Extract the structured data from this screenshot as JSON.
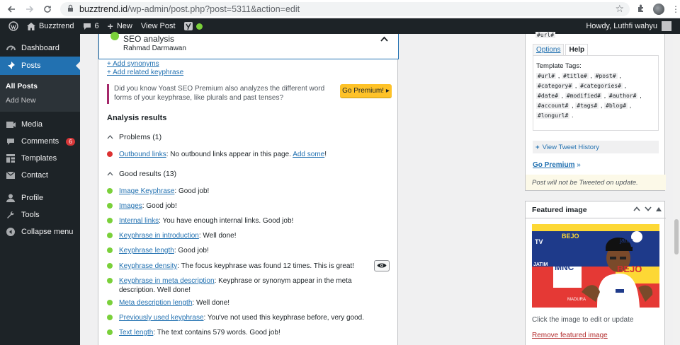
{
  "browser": {
    "url_host": "buzztrend.id",
    "url_path": "/wp-admin/post.php?post=5311&action=edit"
  },
  "adminbar": {
    "site_name": "Buzztrend",
    "comments_count": "6",
    "new_label": "New",
    "view_post_label": "View Post",
    "howdy": "Howdy, Luthfi wahyu"
  },
  "sidebar": {
    "dashboard": "Dashboard",
    "posts": "Posts",
    "all_posts": "All Posts",
    "add_new": "Add New",
    "media": "Media",
    "comments": "Comments",
    "comments_badge": "6",
    "templates": "Templates",
    "contact": "Contact",
    "profile": "Profile",
    "tools": "Tools",
    "collapse": "Collapse menu"
  },
  "seo": {
    "title": "SEO analysis",
    "keyphrase": "Rahmad Darmawan",
    "add_synonyms": "+ Add synonyms",
    "add_related": "+ Add related keyphrase",
    "promo_text": "Did you know Yoast SEO Premium also analyzes the different word forms of your keyphrase, like plurals and past tenses?",
    "go_premium_btn": "Go Premium! ▸",
    "analysis_results": "Analysis results",
    "problems_header": "Problems (1)",
    "good_header": "Good results (13)",
    "problems": [
      {
        "link": "Outbound links",
        "text": ": No outbound links appear in this page. ",
        "extra_link": "Add some",
        "tail": "!"
      }
    ],
    "good": [
      {
        "link": "Image Keyphrase",
        "text": ": Good job!"
      },
      {
        "link": "Images",
        "text": ": Good job!"
      },
      {
        "link": "Internal links",
        "text": ": You have enough internal links. Good job!"
      },
      {
        "link": "Keyphrase in introduction",
        "text": ": Well done!"
      },
      {
        "link": "Keyphrase length",
        "text": ": Good job!"
      },
      {
        "link": "Keyphrase density",
        "text": ": The focus keyphrase was found 12 times. This is great!"
      },
      {
        "link": "Keyphrase in meta description",
        "text": ": Keyphrase or synonym appear in the meta description. Well done!"
      },
      {
        "link": "Meta description length",
        "text": ": Well done!"
      },
      {
        "link": "Previously used keyphrase",
        "text": ": You've not used this keyphrase before, very good."
      },
      {
        "link": "Text length",
        "text": ": The text contains 579 words. Good job!"
      }
    ]
  },
  "tweet_box": {
    "top_tag": "#url#",
    "tab_options": "Options",
    "tab_help": "Help",
    "template_tags_label": "Template Tags:",
    "tags": [
      "#url#",
      "#title#",
      "#post#",
      "#category#",
      "#categories#",
      "#date#",
      "#modified#",
      "#author#",
      "#account#",
      "#tags#",
      "#blog#",
      "#longurl#"
    ],
    "view_history": "View Tweet History",
    "go_premium": "Go Premium",
    "go_premium_suffix": " »",
    "notice": "Post will not be Tweeted on update."
  },
  "featured_image": {
    "title": "Featured image",
    "caption": "Click the image to edit or update",
    "remove": "Remove featured image",
    "image_text_bejo": "BEJO",
    "image_text_mnc": "MNC",
    "image_text_jatim": "JATIM",
    "image_text_tv": "TV",
    "image_text_jatim2": "jatim",
    "image_text_madura": "MADURA"
  }
}
